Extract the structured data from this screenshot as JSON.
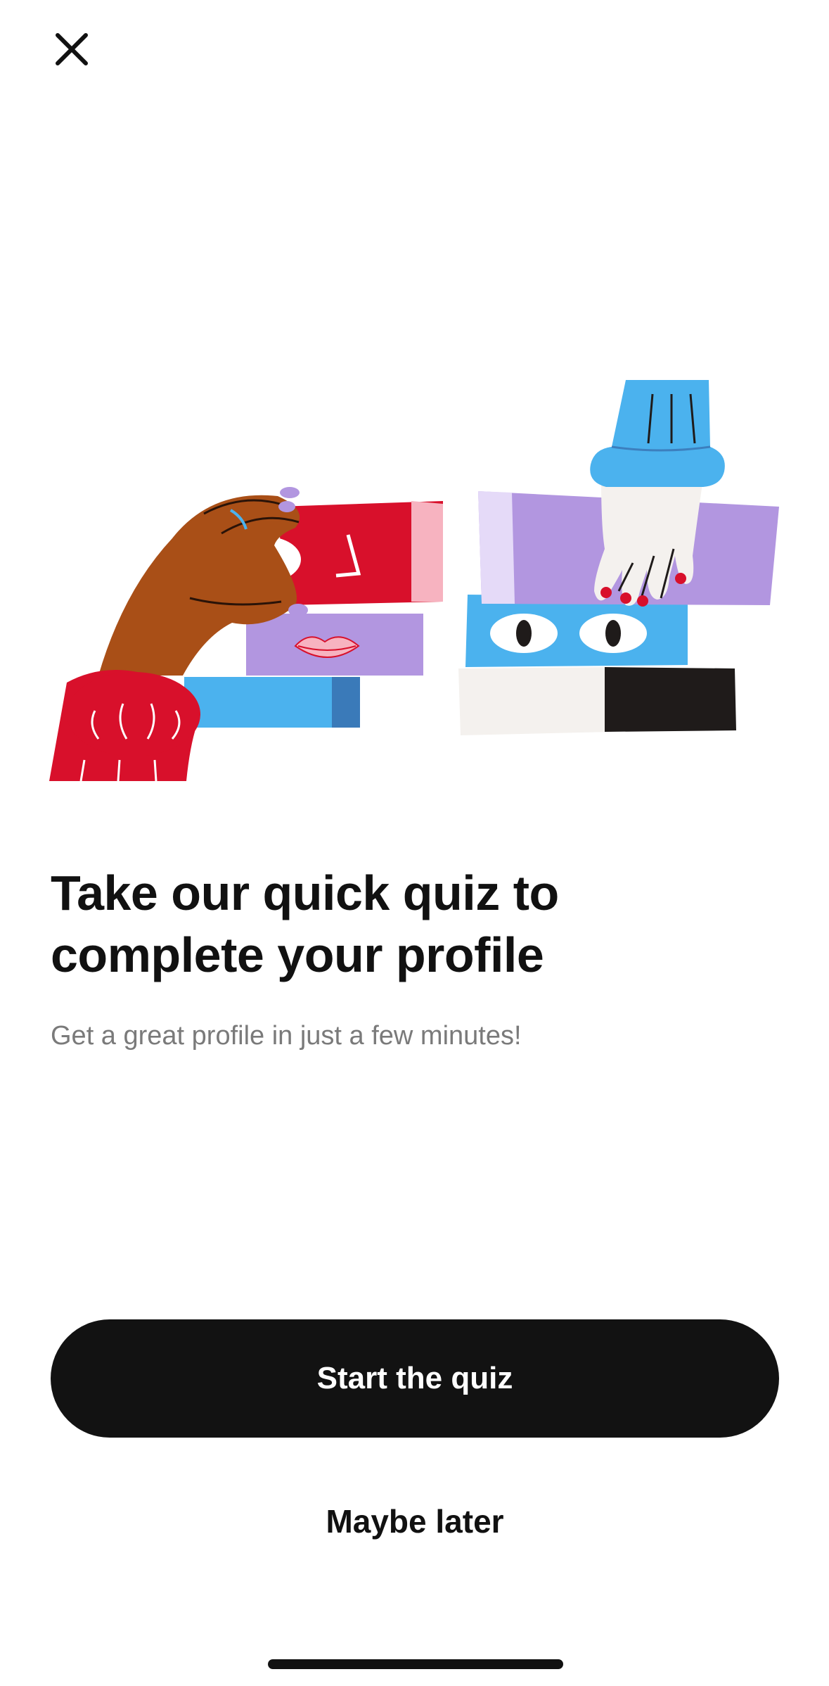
{
  "header": {
    "close_icon": "close-icon"
  },
  "illustration": {
    "name": "profile-quiz-illustration",
    "colors": {
      "red": "#D8102B",
      "pink": "#F7B3C0",
      "purple": "#B296E0",
      "light_purple": "#E5DAF8",
      "blue": "#4BB2EE",
      "brown": "#A94F17",
      "black": "#1F1B1A",
      "cream": "#F4F1EE"
    }
  },
  "content": {
    "headline": "Take our quick quiz to complete your profile",
    "subtitle": "Get a great profile in just a few minutes!"
  },
  "actions": {
    "primary_label": "Start the quiz",
    "secondary_label": "Maybe later"
  },
  "theme": {
    "primary_button_bg": "#121212",
    "primary_button_text": "#FFFFFF",
    "subtitle_color": "#7A7A7A"
  }
}
